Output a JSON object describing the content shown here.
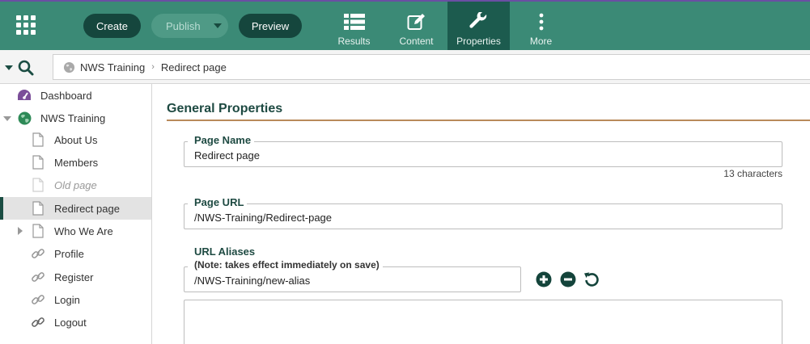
{
  "toolbar": {
    "create_label": "Create",
    "publish_label": "Publish",
    "preview_label": "Preview"
  },
  "nav": [
    {
      "label": "Results",
      "icon": "list-icon"
    },
    {
      "label": "Content",
      "icon": "edit-icon"
    },
    {
      "label": "Properties",
      "icon": "wrench-icon",
      "active": true
    },
    {
      "label": "More",
      "icon": "more-vertical-icon"
    }
  ],
  "breadcrumb": {
    "site": "NWS Training",
    "page": "Redirect page"
  },
  "sidebar": {
    "items": [
      {
        "label": "Dashboard",
        "icon": "dashboard-icon"
      },
      {
        "label": "NWS Training",
        "icon": "globe-icon"
      },
      {
        "label": "About Us",
        "icon": "page-icon"
      },
      {
        "label": "Members",
        "icon": "page-icon"
      },
      {
        "label": "Old page",
        "icon": "page-icon",
        "dim": true
      },
      {
        "label": "Redirect page",
        "icon": "page-icon",
        "selected": true
      },
      {
        "label": "Who We Are",
        "icon": "page-icon"
      },
      {
        "label": "Profile",
        "icon": "link-icon"
      },
      {
        "label": "Register",
        "icon": "link-icon"
      },
      {
        "label": "Login",
        "icon": "link-icon"
      },
      {
        "label": "Logout",
        "icon": "link-icon"
      }
    ]
  },
  "main": {
    "section_title": "General Properties",
    "page_name": {
      "label": "Page Name",
      "value": "Redirect page",
      "hint": "13 characters"
    },
    "page_url": {
      "label": "Page URL",
      "value": "/NWS-Training/Redirect-page"
    },
    "url_aliases": {
      "label": "URL Aliases",
      "note": "(Note: takes effect immediately on save)",
      "value": "/NWS-Training/new-alias"
    }
  },
  "colors": {
    "topbar": "#3b8a76",
    "dark_button": "#15463d",
    "active_tab": "#1c5b4e",
    "accent_rule": "#b98a5a",
    "heading": "#1e4a42"
  }
}
